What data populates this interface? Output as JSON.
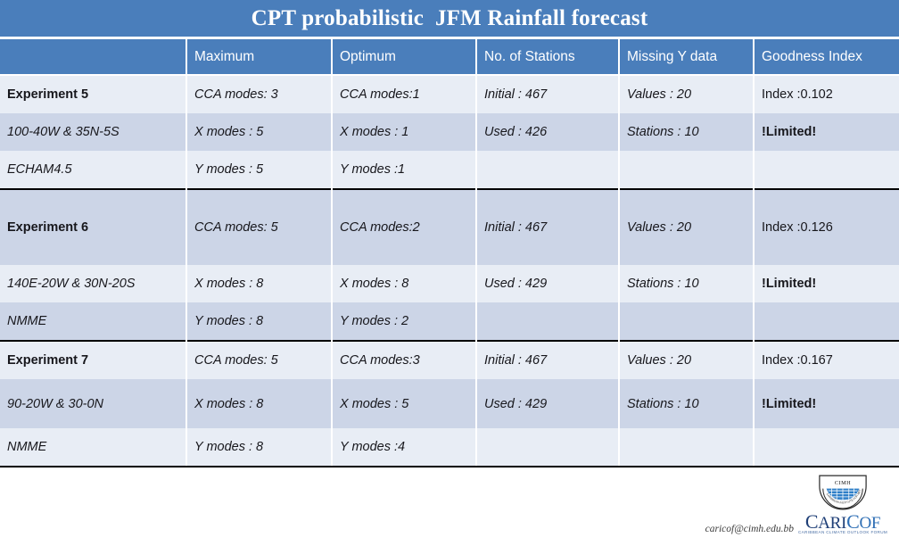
{
  "title": "CPT probabilistic  JFM Rainfall forecast",
  "table": {
    "headers": [
      "",
      "Maximum",
      "Optimum",
      "No. of Stations",
      "Missing Y data",
      "Goodness Index"
    ],
    "rows": [
      {
        "cells": [
          "Experiment 5",
          "CCA modes: 3",
          "CCA modes:1",
          "Initial : 467",
          "Values : 20",
          "Index :0.102"
        ]
      },
      {
        "cells": [
          "100-40W & 35N-5S",
          "X modes : 5",
          "X modes : 1",
          "Used : 426",
          "Stations : 10",
          "!Limited!"
        ]
      },
      {
        "cells": [
          "ECHAM4.5",
          "Y modes : 5",
          "Y modes :1",
          "",
          "",
          ""
        ]
      },
      {
        "cells": [
          "Experiment 6",
          "CCA modes: 5",
          "CCA modes:2",
          "Initial : 467",
          "Values : 20",
          "Index :0.126"
        ]
      },
      {
        "cells": [
          "140E-20W & 30N-20S",
          "X modes : 8",
          "X modes : 8",
          "Used : 429",
          "Stations : 10",
          "!Limited!"
        ]
      },
      {
        "cells": [
          "NMME",
          "Y modes : 8",
          "Y modes : 2",
          "",
          "",
          ""
        ]
      },
      {
        "cells": [
          "Experiment 7",
          "CCA modes: 5",
          "CCA modes:3",
          "Initial : 467",
          "Values : 20",
          "Index :0.167"
        ]
      },
      {
        "cells": [
          "90-20W & 30-0N",
          "X modes : 8",
          "X modes : 5",
          "Used : 429",
          "Stations : 10",
          "!Limited!"
        ]
      },
      {
        "cells": [
          "NMME",
          "Y modes : 8",
          "Y modes :4",
          "",
          "",
          ""
        ]
      }
    ]
  },
  "footer": {
    "email": "caricof@cimh.edu.bb",
    "seal_label": "CIMH",
    "logo_part1": "C",
    "logo_part2": "ARI",
    "logo_part3": "C",
    "logo_part4": "OF",
    "logo_tagline": "CARIBBEAN CLIMATE OUTLOOK FORUM"
  },
  "colors": {
    "banner_blue": "#4a7ebb",
    "row_light": "#e8edf5",
    "row_dark": "#ccd5e7",
    "logo_navy": "#1f3f77"
  }
}
